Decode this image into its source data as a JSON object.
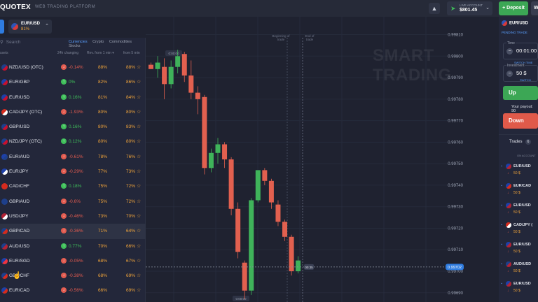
{
  "app": {
    "logo": "QUOTEX",
    "subtitle": "WEB TRADING PLATFORM"
  },
  "account": {
    "label": "LIVE ACCOUNT",
    "balance": "$801.45"
  },
  "buttons": {
    "deposit": "+ Deposit",
    "withdraw": "W"
  },
  "asset_tab": {
    "name": "EUR/USD",
    "payout": "81%"
  },
  "asset_panel": {
    "search_placeholder": "Search",
    "categories": [
      "Currencies",
      "Crypto",
      "Commodities",
      "Stocks"
    ],
    "active_category": "Currencies",
    "headers": {
      "asset": "ssets",
      "change": "24h changing",
      "rev1": "Rev. from 1 min ▾",
      "rev5": "from 5 min"
    },
    "rows": [
      {
        "name": "NZD/USD (OTC)",
        "change": "-0.14%",
        "dir": "down",
        "p1": "88%",
        "p5": "88%",
        "flag": [
          "#1e3f8a",
          "#c8102e"
        ]
      },
      {
        "name": "EUR/GBP",
        "change": "0%",
        "dir": "up",
        "p1": "82%",
        "p5": "86%",
        "flag": [
          "#1e40a8",
          "#c8102e"
        ]
      },
      {
        "name": "EUR/USD",
        "change": "0.16%",
        "dir": "up",
        "p1": "81%",
        "p5": "84%",
        "flag": [
          "#1e40a8",
          "#c8102e"
        ]
      },
      {
        "name": "CAD/JPY (OTC)",
        "change": "-1.93%",
        "dir": "down",
        "p1": "80%",
        "p5": "80%",
        "flag": [
          "#d52b1e",
          "#ffffff"
        ]
      },
      {
        "name": "GBP/USD",
        "change": "0.16%",
        "dir": "up",
        "p1": "80%",
        "p5": "83%",
        "flag": [
          "#1e3f8a",
          "#c8102e"
        ]
      },
      {
        "name": "NZD/JPY (OTC)",
        "change": "0.12%",
        "dir": "up",
        "p1": "80%",
        "p5": "80%",
        "flag": [
          "#1e3f8a",
          "#c8102e"
        ]
      },
      {
        "name": "EUR/AUD",
        "change": "-0.61%",
        "dir": "down",
        "p1": "78%",
        "p5": "76%",
        "flag": [
          "#1e40a8",
          "#1e3f8a"
        ]
      },
      {
        "name": "EUR/JPY",
        "change": "-0.29%",
        "dir": "down",
        "p1": "77%",
        "p5": "73%",
        "flag": [
          "#1e40a8",
          "#ffffff"
        ]
      },
      {
        "name": "CAD/CHF",
        "change": "0.18%",
        "dir": "up",
        "p1": "75%",
        "p5": "72%",
        "flag": [
          "#d52b1e",
          "#d52b1e"
        ]
      },
      {
        "name": "GBP/AUD",
        "change": "-0.6%",
        "dir": "down",
        "p1": "75%",
        "p5": "72%",
        "flag": [
          "#1e3f8a",
          "#1e3f8a"
        ]
      },
      {
        "name": "USD/JPY",
        "change": "-0.46%",
        "dir": "down",
        "p1": "73%",
        "p5": "70%",
        "flag": [
          "#b22234",
          "#ffffff"
        ]
      },
      {
        "name": "GBP/CAD",
        "change": "-0.36%",
        "dir": "down",
        "p1": "71%",
        "p5": "64%",
        "flag": [
          "#1e3f8a",
          "#d52b1e"
        ]
      },
      {
        "name": "AUD/USD",
        "change": "0.77%",
        "dir": "up",
        "p1": "70%",
        "p5": "66%",
        "flag": [
          "#1e3f8a",
          "#b22234"
        ]
      },
      {
        "name": "EUR/SGD",
        "change": "-0.05%",
        "dir": "down",
        "p1": "68%",
        "p5": "67%",
        "flag": [
          "#1e40a8",
          "#ef3340"
        ]
      },
      {
        "name": "GBP/CHF",
        "change": "-0.38%",
        "dir": "down",
        "p1": "68%",
        "p5": "69%",
        "flag": [
          "#1e3f8a",
          "#d52b1e"
        ]
      },
      {
        "name": "EUR/CAD",
        "change": "-0.56%",
        "dir": "down",
        "p1": "66%",
        "p5": "69%",
        "flag": [
          "#1e40a8",
          "#d52b1e"
        ]
      }
    ],
    "highlighted_row": 11
  },
  "chart": {
    "watermark": "SMART TRADING",
    "beginning_label": "Beginning of trade",
    "end_label": "End of trade",
    "top_time": "0:00:00",
    "bottom_time": "0:00:00",
    "current_price": "0.99702",
    "timer": "00:35",
    "y_ticks": [
      "0.99810",
      "0.99800",
      "0.99790",
      "0.99780",
      "0.99770",
      "0.99760",
      "0.99750",
      "0.99740",
      "0.99730",
      "0.99720",
      "0.99710",
      "0.99700",
      "0.99690"
    ],
    "colors": {
      "up": "#3fb35a",
      "down": "#e2604f"
    }
  },
  "chart_data": {
    "type": "candlestick",
    "ylim": [
      0.99687,
      0.99817
    ],
    "candles": [
      {
        "o": 0.99796,
        "h": 0.99797,
        "l": 0.99794,
        "c": 0.99794
      },
      {
        "o": 0.99794,
        "h": 0.998,
        "l": 0.9979,
        "c": 0.99797
      },
      {
        "o": 0.99795,
        "h": 0.99799,
        "l": 0.9978,
        "c": 0.99787
      },
      {
        "o": 0.99787,
        "h": 0.99798,
        "l": 0.99785,
        "c": 0.99795
      },
      {
        "o": 0.99795,
        "h": 0.99803,
        "l": 0.99792,
        "c": 0.998
      },
      {
        "o": 0.99801,
        "h": 0.99802,
        "l": 0.99788,
        "c": 0.99791
      },
      {
        "o": 0.99791,
        "h": 0.99798,
        "l": 0.9978,
        "c": 0.99783
      },
      {
        "o": 0.99783,
        "h": 0.99786,
        "l": 0.99773,
        "c": 0.9978
      },
      {
        "o": 0.99781,
        "h": 0.99782,
        "l": 0.99745,
        "c": 0.99748
      },
      {
        "o": 0.99748,
        "h": 0.99757,
        "l": 0.99746,
        "c": 0.99755
      },
      {
        "o": 0.99755,
        "h": 0.99762,
        "l": 0.9975,
        "c": 0.99759
      },
      {
        "o": 0.99759,
        "h": 0.9976,
        "l": 0.99748,
        "c": 0.99752
      },
      {
        "o": 0.99752,
        "h": 0.99753,
        "l": 0.99726,
        "c": 0.99729
      },
      {
        "o": 0.99729,
        "h": 0.99732,
        "l": 0.99706,
        "c": 0.99709
      },
      {
        "o": 0.99704,
        "h": 0.99705,
        "l": 0.99687,
        "c": 0.99691
      },
      {
        "o": 0.99691,
        "h": 0.99734,
        "l": 0.99689,
        "c": 0.99733
      },
      {
        "o": 0.99733,
        "h": 0.99747,
        "l": 0.99732,
        "c": 0.99747
      },
      {
        "o": 0.99747,
        "h": 0.99748,
        "l": 0.9974,
        "c": 0.99742
      },
      {
        "o": 0.99742,
        "h": 0.99743,
        "l": 0.99729,
        "c": 0.99732
      },
      {
        "o": 0.99731,
        "h": 0.99733,
        "l": 0.99721,
        "c": 0.99723
      },
      {
        "o": 0.99723,
        "h": 0.99724,
        "l": 0.99714,
        "c": 0.99716
      },
      {
        "o": 0.99716,
        "h": 0.99717,
        "l": 0.99698,
        "c": 0.997
      },
      {
        "o": 0.997,
        "h": 0.99707,
        "l": 0.99699,
        "c": 0.99705
      }
    ]
  },
  "right_panel": {
    "asset": "EUR/USD",
    "pending": "PENDING TRADE",
    "time_label": "Time",
    "time_value": "00:01:00",
    "switch_time": "SWITCH TIME",
    "investment_label": "Investment",
    "investment_value": "50 $",
    "switch": "SWITCH",
    "up": "Up",
    "payout": "Your payout: 90",
    "down": "Down",
    "trades_label": "Trades",
    "trades_count": "6",
    "account_header": "ON ACCOUNT",
    "trades": [
      {
        "name": "EUR/USD",
        "amount": "50 $",
        "flag": [
          "#1e40a8",
          "#b22234"
        ]
      },
      {
        "name": "EUR/CAD",
        "amount": "50 $",
        "flag": [
          "#1e40a8",
          "#d52b1e"
        ]
      },
      {
        "name": "EUR/USD",
        "amount": "50 $",
        "flag": [
          "#1e40a8",
          "#b22234"
        ]
      },
      {
        "name": "CAD/JPY (",
        "amount": "50 $",
        "flag": [
          "#d52b1e",
          "#ffffff"
        ]
      },
      {
        "name": "EUR/USD",
        "amount": "50 $",
        "flag": [
          "#1e40a8",
          "#b22234"
        ]
      },
      {
        "name": "AUD/USD",
        "amount": "50 $",
        "flag": [
          "#1e3f8a",
          "#b22234"
        ]
      },
      {
        "name": "EUR/USD",
        "amount": "50 $",
        "flag": [
          "#1e40a8",
          "#b22234"
        ]
      }
    ]
  }
}
